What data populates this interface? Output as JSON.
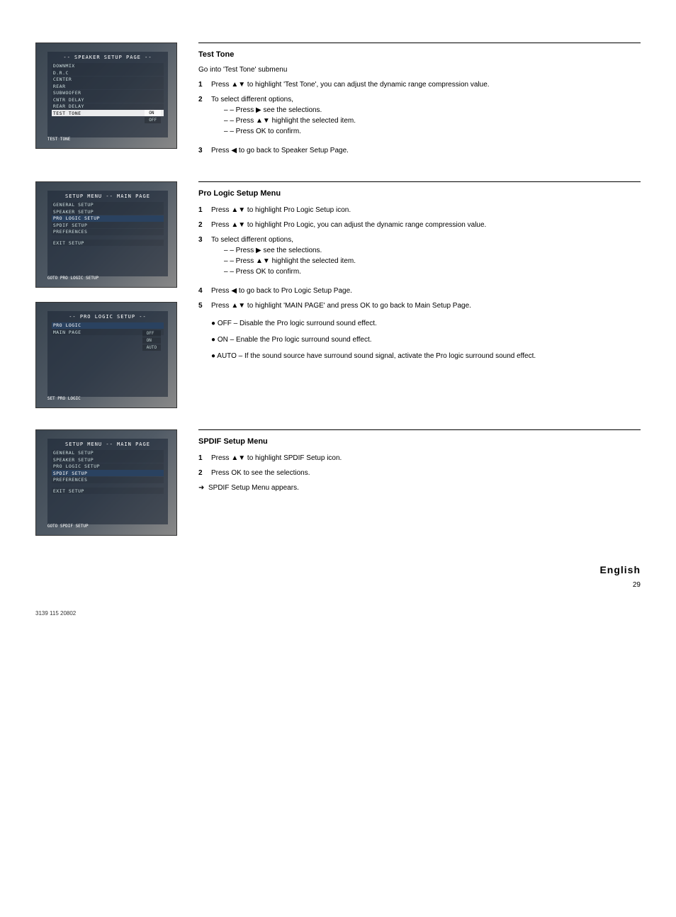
{
  "sections": {
    "testTone": {
      "title": "Test Tone",
      "intro": "Go into 'Test Tone' submenu",
      "step1_a": "Press ",
      "step1_b": " to highlight 'Test Tone', you can adjust the dynamic range compression value.",
      "step2_a": "To select different options, ",
      "step2_b": "– Press ",
      "step2_c": " see the selections.",
      "step2_d": "– Press ",
      "step2_e": " highlight the selected item.",
      "step2_f": "– Press OK to confirm.",
      "step3_a": "Press ",
      "step3_b": " to go back to Speaker Setup Page.",
      "scr": {
        "title": "-- SPEAKER SETUP PAGE --",
        "items": [
          "DOWNMIX",
          "D.R.C",
          "CENTER",
          "REAR",
          "SUBWOOFER",
          "CNTR DELAY",
          "REAR DELAY",
          "TEST TONE"
        ],
        "sub": [
          "ON",
          "OFF"
        ],
        "footer": "TEST TONE"
      }
    },
    "proLogic": {
      "title": "Pro Logic Setup Menu",
      "step1_a": "Press ",
      "step1_b": " to highlight Pro Logic Setup icon.",
      "step2_a": "Press ",
      "step2_b": " to highlight Pro Logic, you can adjust the dynamic range compression value.",
      "step3_a": "To select different options, ",
      "step3_b": "– Press ",
      "step3_c": " see the selections.",
      "step3_d": "– Press ",
      "step3_e": " highlight the selected item.",
      "step3_f": "– Press OK to confirm.",
      "step4_a": "Press ",
      "step4_b": " to go back to Pro Logic Setup Page.",
      "step5_a": "Press ",
      "step5_b": " to highlight 'MAIN PAGE' and press OK to go back to Main Setup Page.",
      "opt_off": "OFF – Disable the Pro logic surround sound effect.",
      "opt_on": "ON – Enable the Pro logic surround sound effect.",
      "opt_auto": "AUTO – If the sound source have surround sound signal, activate the Pro logic surround sound effect.",
      "scr1": {
        "title": "SETUP MENU -- MAIN PAGE",
        "items": [
          "GENERAL SETUP",
          "SPEAKER SETUP",
          "PRO LOGIC SETUP",
          "SPDIF SETUP",
          "PREFERENCES",
          "",
          "EXIT SETUP"
        ],
        "footer": "GOTO PRO LOGIC SETUP"
      },
      "scr2": {
        "title": "-- PRO LOGIC SETUP --",
        "items": [
          "PRO LOGIC",
          "MAIN PAGE"
        ],
        "sub": [
          "OFF",
          "ON",
          "AUTO"
        ],
        "footer": "SET PRO LOGIC"
      }
    },
    "spdif": {
      "title": "SPDIF Setup Menu",
      "step1_a": "Press ",
      "step1_b": " to highlight SPDIF Setup icon.",
      "step2": "Press OK to see the selections.",
      "arrow": "SPDIF Setup Menu appears.",
      "scr": {
        "title": "SETUP MENU -- MAIN PAGE",
        "items": [
          "GENERAL SETUP",
          "SPEAKER SETUP",
          "PRO LOGIC SETUP",
          "SPDIF SETUP",
          "PREFERENCES",
          "",
          "EXIT SETUP"
        ],
        "footer": "GOTO SPDIF SETUP"
      }
    }
  },
  "englishLabel": "English",
  "pageNumber": "29",
  "footerLine": "3139 115 20802"
}
